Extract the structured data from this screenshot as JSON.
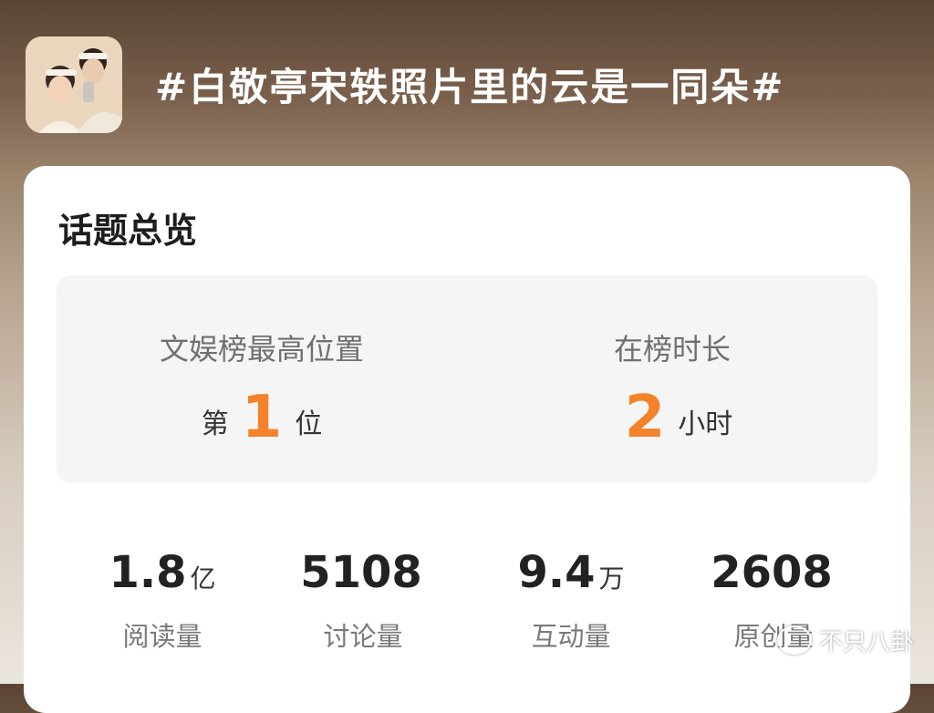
{
  "header": {
    "title": "#白敬亭宋轶照片里的云是一同朵#"
  },
  "overview": {
    "title": "话题总览",
    "left": {
      "label": "文娱榜最高位置",
      "prefix": "第",
      "value": "1",
      "suffix": "位"
    },
    "right": {
      "label": "在榜时长",
      "value": "2",
      "suffix": "小时"
    }
  },
  "metrics": [
    {
      "number": "1.8",
      "unit": "亿",
      "label": "阅读量"
    },
    {
      "number": "5108",
      "unit": "",
      "label": "讨论量"
    },
    {
      "number": "9.4",
      "unit": "万",
      "label": "互动量"
    },
    {
      "number": "2608",
      "unit": "",
      "label": "原创量"
    }
  ],
  "watermark": {
    "text": "不只八卦",
    "icon": "wechat-icon"
  },
  "colors": {
    "accent": "#f4822a",
    "card": "#ffffff",
    "panel": "#f5f5f5"
  }
}
